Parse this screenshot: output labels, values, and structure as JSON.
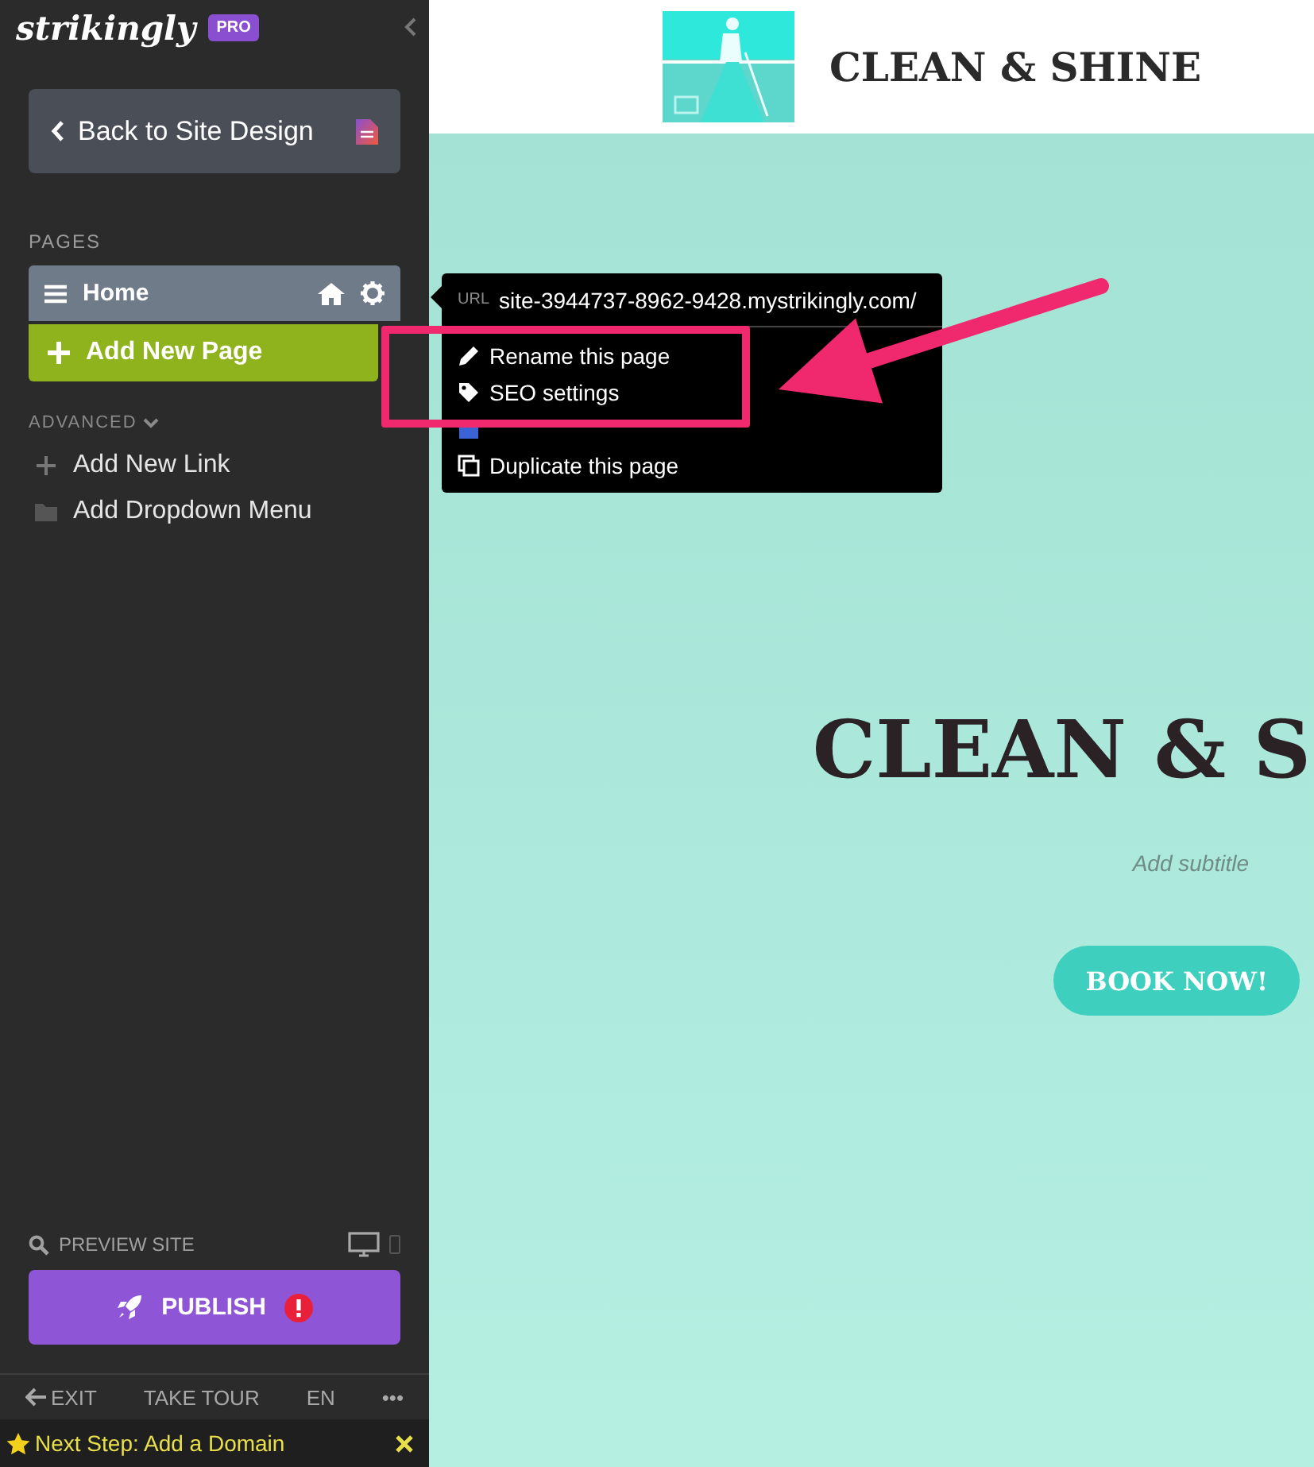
{
  "sidebar": {
    "brand": "strikingly",
    "badge": "PRO",
    "back_button": "Back to Site Design",
    "pages_heading": "PAGES",
    "pages": [
      {
        "label": "Home",
        "selected": true
      }
    ],
    "add_page_button": "Add New Page",
    "advanced_label": "ADVANCED",
    "advanced_items": [
      {
        "kind": "link",
        "label": "Add New Link"
      },
      {
        "kind": "dropdown",
        "label": "Add Dropdown Menu"
      }
    ],
    "preview_label": "PREVIEW SITE",
    "publish_button": "PUBLISH",
    "footer": [
      {
        "kind": "exit",
        "label": "EXIT"
      },
      {
        "kind": "text",
        "label": "TAKE TOUR"
      },
      {
        "kind": "text",
        "label": "EN"
      },
      {
        "kind": "text",
        "label": "•••"
      }
    ],
    "next_step": "Next Step: Add a Domain"
  },
  "page_menu": {
    "url_label": "URL",
    "url": "site-3944737-8962-9428.mystrikingly.com/",
    "items": [
      {
        "kind": "rename",
        "label": "Rename this page"
      },
      {
        "kind": "seo",
        "label": "SEO settings"
      },
      {
        "kind": "navigation"
      },
      {
        "kind": "duplicate",
        "label": "Duplicate this page"
      }
    ]
  },
  "site": {
    "header_title": "CLEAN & SHINE",
    "hero_title": "CLEAN & S",
    "subtitle": "Add subtitle",
    "button": "BOOK NOW!"
  }
}
